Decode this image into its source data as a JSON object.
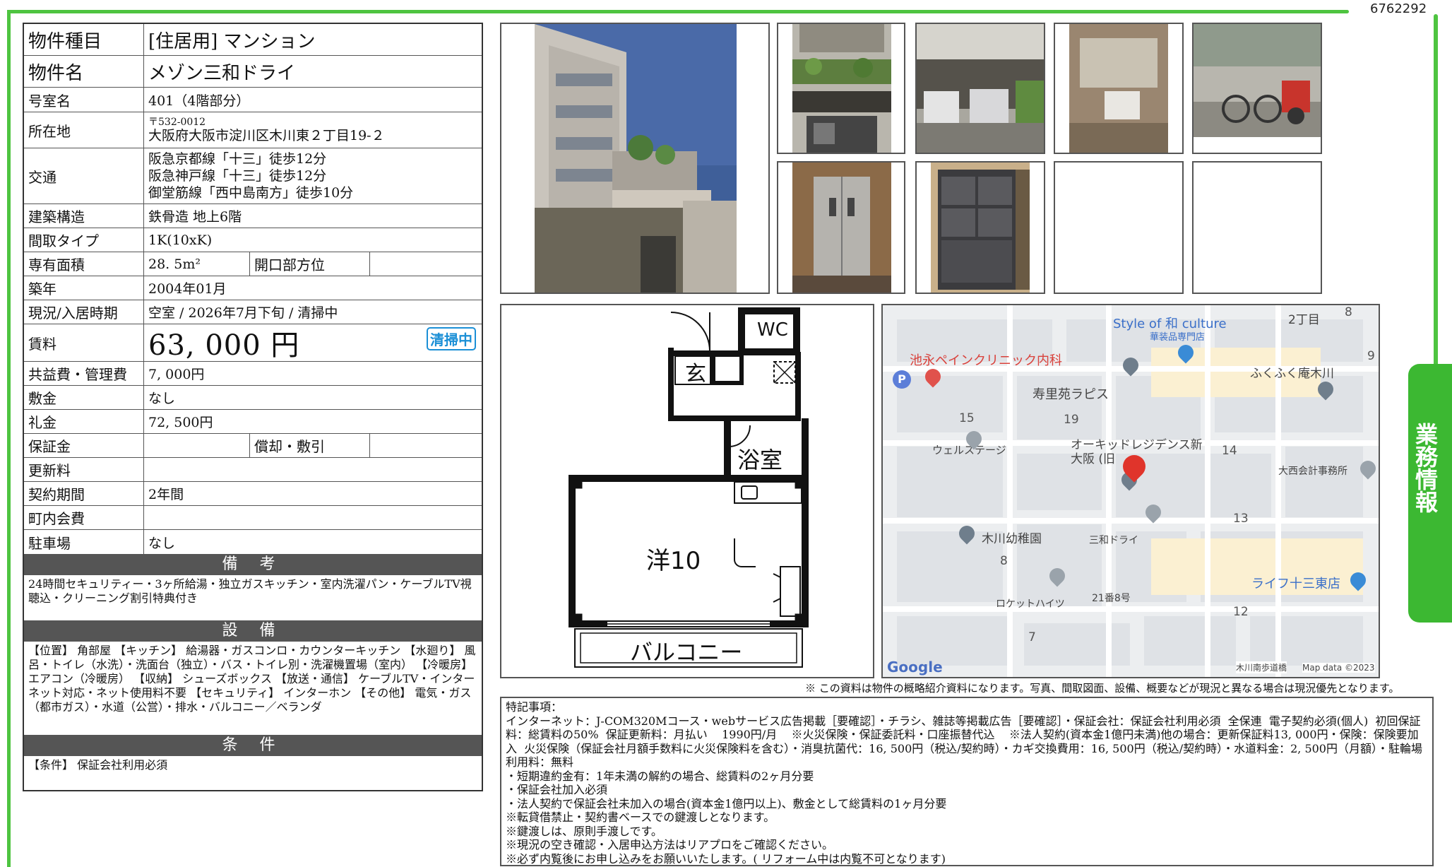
{
  "doc_id": "6762292",
  "property": {
    "type": {
      "label": "物件種目",
      "value": "[住居用]  マンション"
    },
    "name": {
      "label": "物件名",
      "value": "メゾン三和ドライ"
    },
    "room": {
      "label": "号室名",
      "value": "401（4階部分）"
    },
    "address": {
      "label": "所在地",
      "zip": "〒532-0012",
      "value": "大阪府大阪市淀川区木川東２丁目19-２"
    },
    "transport": {
      "label": "交通",
      "lines": [
        "阪急京都線「十三」徒歩12分",
        "阪急神戸線「十三」徒歩12分",
        "御堂筋線「西中島南方」徒歩10分"
      ]
    },
    "structure": {
      "label": "建築構造",
      "value": "鉄骨造  地上6階"
    },
    "layout_type": {
      "label": "間取タイプ",
      "value": "1K(10xK)"
    },
    "area": {
      "label": "専有面積",
      "value": "28. 5m²",
      "label2": "開口部方位",
      "value2": ""
    },
    "built": {
      "label": "築年",
      "value": "2004年01月"
    },
    "status": {
      "label": "現況/入居時期",
      "value": "空室  /  2026年7月下旬  /  清掃中",
      "badge": "清掃中"
    },
    "rent": {
      "label": "賃料",
      "value": "63, 000  円"
    },
    "common_fee": {
      "label": "共益費・管理費",
      "value": "7, 000円"
    },
    "deposit": {
      "label": "敷金",
      "value": "なし"
    },
    "key_money": {
      "label": "礼金",
      "value": "72, 500円"
    },
    "guarantee": {
      "label": "保証金",
      "value": "",
      "label2": "償却・敷引",
      "value2": ""
    },
    "renewal": {
      "label": "更新料",
      "value": ""
    },
    "contract": {
      "label": "契約期間",
      "value": "2年間"
    },
    "town_fee": {
      "label": "町内会費",
      "value": ""
    },
    "parking": {
      "label": "駐車場",
      "value": "なし"
    }
  },
  "remarks": {
    "title": "備 考",
    "text": "24時間セキュリティー・3ヶ所給湯・独立ガスキッチン・室内洗濯パン・ケーブルTV視聴込・クリーニング割引特典付き"
  },
  "facilities": {
    "title": "設 備",
    "text": "【位置】 角部屋 【キッチン】 給湯器・ガスコンロ・カウンターキッチン 【水廻り】 風呂・トイレ（水洗）・洗面台（独立）・バス・トイレ別・洗濯機置場（室内） 【冷暖房】 エアコン（冷暖房） 【収納】 シューズボックス 【放送・通信】 ケーブルTV・インターネット対応・ネット使用料不要 【セキュリティ】 インターホン 【その他】 電気・ガス（都市ガス）・水道（公営）・排水・バルコニー／ベランダ"
  },
  "conditions": {
    "title": "条 件",
    "text": "【条件】 保証会社利用必須"
  },
  "floorplan": {
    "wc": "WC",
    "entrance": "玄",
    "bath": "浴室",
    "room": "洋10",
    "balcony": "バルコニー"
  },
  "map": {
    "labels": {
      "style": "Style of 和 culture",
      "style_sub": "華装品専門店",
      "clinic": "池永ペインクリニック内科",
      "fukufuku": "ふくふく庵木川",
      "juri": "寿里苑ラピス",
      "welstage": "ウェルステージ",
      "orchid": "オーキッドレジデンス新大阪 (旧",
      "onishi": "大西会計事務所",
      "kindergarten": "木川幼稚園",
      "sanwa": "三和ドライ",
      "life": "ライフ十三東店",
      "rocket": "ロケットハイツ",
      "no21": "21番8号",
      "chome2": "2丁目",
      "google": "Google",
      "mapdata": "Map data ©2023",
      "minami": "木川南歩道橋"
    },
    "numbers": [
      "8",
      "9",
      "15",
      "19",
      "14",
      "13",
      "8",
      "12",
      "7"
    ]
  },
  "note": "※ この資料は物件の概略紹介資料になります。写真、間取図面、設備、概要などが現況と異なる場合は現況優先となります。",
  "special": {
    "title": "特記事項：",
    "lines": [
      "インターネット：J-COM320Mコース・webサービス広告掲載［要確認］・チラシ、雑誌等掲載広告［要確認］・保証会社：保証会社利用必須  全保連  電子契約必須(個人)  初回保証料：総賃料の50%  保証更新料：月払い    1990円/月    ※火災保険・保証委託料・口座振替代込    ※法人契約(資本金1億円未満)他の場合：更新保証料13, 000円・保険：保険要加入  火災保険（保証会社月額手数料に火災保険料を含む）・消臭抗菌代：16, 500円（税込/契約時）・カギ交換費用：16, 500円（税込/契約時）・水道料金：2, 500円（月額）・駐輪場利用料：無料",
      "・短期違約金有：1年未満の解約の場合、総賃料の2ヶ月分要",
      "・保証会社加入必須",
      "・法人契約で保証会社未加入の場合(資本金1億円以上)、敷金として総賃料の1ヶ月分要",
      "※転貸借禁止・契約書ベースでの鍵渡しとなります。",
      "※鍵渡しは、原則手渡しです。",
      "※現況の空き確認・入居申込方法はリアプロをご確認ください。",
      "※必ず内覧後にお申し込みをお願いいたします。( リフォーム中は内覧不可となります)"
    ]
  },
  "side_tab": "業務情報"
}
